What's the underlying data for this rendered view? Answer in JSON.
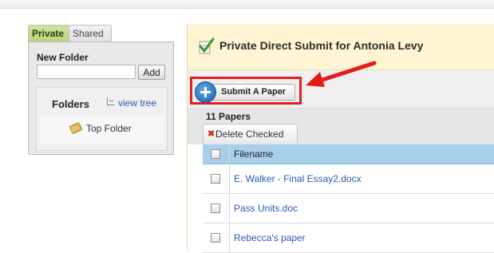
{
  "sidebar": {
    "tabs": [
      {
        "label": "Private",
        "active": true
      },
      {
        "label": "Shared",
        "active": false
      }
    ],
    "new_folder": {
      "label": "New Folder",
      "input_value": "",
      "input_placeholder": "",
      "add_label": "Add"
    },
    "folders": {
      "title": "Folders",
      "view_tree_label": "view tree",
      "items": [
        {
          "label": "Top Folder",
          "icon": "folder-icon"
        }
      ]
    }
  },
  "main": {
    "header": {
      "title": "Private Direct Submit for Antonia Levy",
      "icon": "document-check-icon"
    },
    "toolbar": {
      "submit_label": "Submit A Paper",
      "submit_icon": "plus-circle-icon"
    },
    "papers": {
      "count_label": "11 Papers",
      "delete_label": "Delete Checked",
      "delete_icon": "x-icon"
    },
    "table": {
      "columns": [
        "Filename"
      ],
      "rows": [
        {
          "filename": "E. Walker - Final Essay2.docx"
        },
        {
          "filename": "Pass Units.doc"
        },
        {
          "filename": "Rebecca's paper"
        }
      ]
    }
  },
  "colors": {
    "header_bg": "#fff5d2",
    "active_tab": "#b7d57c",
    "table_header": "#a9d0ea",
    "highlight_red": "#e02020",
    "link": "#2a58b5"
  }
}
